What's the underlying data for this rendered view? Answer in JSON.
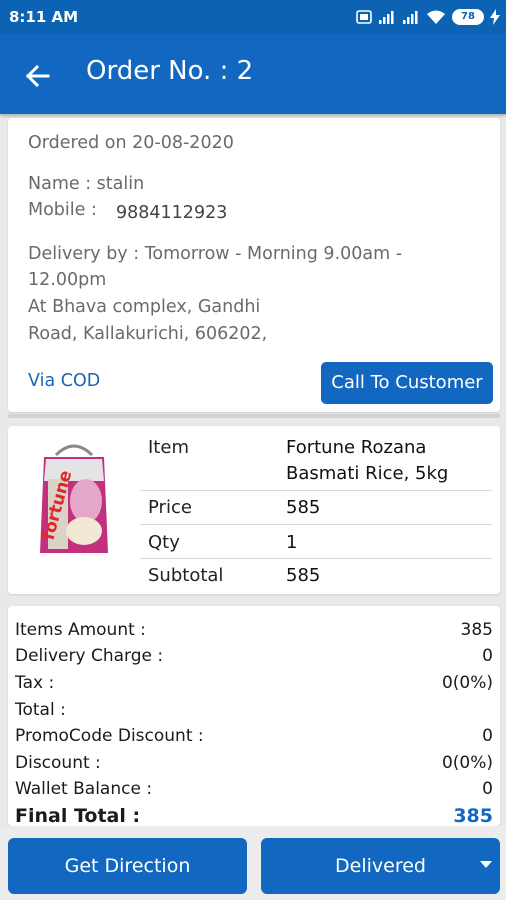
{
  "status_bar": {
    "time": "8:11 AM",
    "battery": "78",
    "icons": [
      "sim-icon",
      "signal-icon",
      "signal-icon",
      "wifi-icon",
      "battery-icon",
      "charging-icon"
    ]
  },
  "app_bar": {
    "back_icon": "arrow-left-icon",
    "title": "Order No. : 2"
  },
  "order_info": {
    "ordered_on": "Ordered on 20-08-2020",
    "name": "Name : stalin",
    "mobile_label": "Mobile :",
    "mobile_value": "9884112923",
    "delivery_line1": "Delivery by : Tomorrow - Morning 9.00am -",
    "delivery_line2": "12.00pm",
    "address_line1": "At Bhava complex, Gandhi",
    "address_line2": "Road, Kallakurichi, 606202,",
    "payment": "Via COD",
    "call_button": "Call To Customer"
  },
  "item": {
    "item_label": "Item",
    "item_line1": "Fortune Rozana",
    "item_line2": "Basmati Rice, 5kg",
    "price_label": "Price",
    "price": "585",
    "qty_label": "Qty",
    "qty": "1",
    "subtotal_label": "Subtotal",
    "subtotal": "585",
    "image_brand": "fortune"
  },
  "summary": {
    "rows": [
      {
        "label": "Items Amount :",
        "value": "385"
      },
      {
        "label": "Delivery Charge :",
        "value": "0"
      },
      {
        "label": "Tax :",
        "value": "0(0%)"
      },
      {
        "label": "Total :",
        "value": ""
      },
      {
        "label": "PromoCode Discount :",
        "value": "0"
      },
      {
        "label": "Discount :",
        "value": "0(0%)"
      },
      {
        "label": "Wallet Balance :",
        "value": "0"
      }
    ],
    "final_label": "Final Total :",
    "final_value": "385"
  },
  "actions": {
    "direction": "Get Direction",
    "status": "Delivered",
    "dropdown_icon": "caret-down-icon"
  },
  "colors": {
    "primary": "#1267c0",
    "status_bar": "#0d63b3"
  }
}
